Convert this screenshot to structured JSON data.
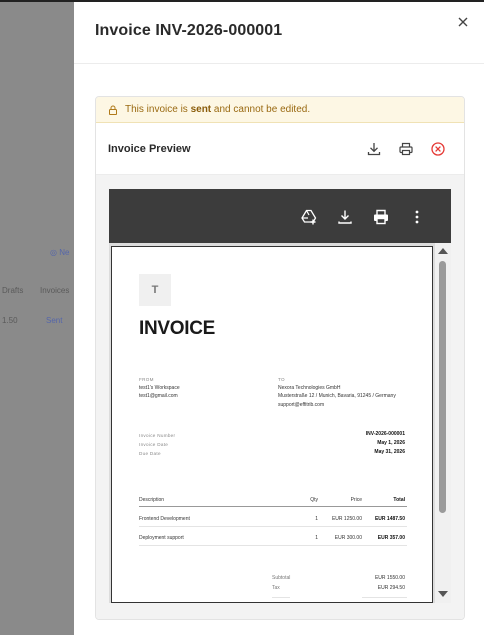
{
  "background": {
    "fragments": [
      "◎ Ne",
      "Drafts",
      "Invoices",
      "1.50",
      "Sent"
    ]
  },
  "drawer": {
    "title": "Invoice INV-2026-000001",
    "close_icon": "close-icon"
  },
  "alert": {
    "prefix": "This invoice is ",
    "status": "sent",
    "suffix": " and cannot be edited.",
    "icon": "lock-icon",
    "color": "#9a6a12"
  },
  "preview": {
    "title": "Invoice Preview",
    "actions": [
      "download-icon",
      "print-icon",
      "close-circle-icon"
    ],
    "close_color": "#e53935"
  },
  "viewer": {
    "toolbar_icons": [
      "add-to-drive-icon",
      "download-icon",
      "print-icon",
      "more-vert-icon"
    ]
  },
  "invoice": {
    "logo_letter": "T",
    "title": "INVOICE",
    "from_label": "FROM",
    "from_lines": [
      "test1's Workspace",
      "test1@gmail.com"
    ],
    "to_label": "TO",
    "to_lines": [
      "Nexora Technologies GmbH",
      "Musterstraße 12 / Munich, Bavaria, 91245 / Germany",
      "support@effitrib.com"
    ],
    "meta": [
      {
        "label": "Invoice Number",
        "value": "INV-2026-000001"
      },
      {
        "label": "Invoice Date",
        "value": "May 1, 2026"
      },
      {
        "label": "Due Date",
        "value": "May 31, 2026"
      }
    ],
    "columns": [
      "Description",
      "Qty",
      "Price",
      "Total"
    ],
    "items": [
      {
        "description": "Frontend Development",
        "qty": "1",
        "price": "EUR 1250.00",
        "total": "EUR 1487.50"
      },
      {
        "description": "Deployment support",
        "qty": "1",
        "price": "EUR 300.00",
        "total": "EUR 357.00"
      }
    ],
    "totals": [
      {
        "label": "Subtotal",
        "value": "EUR 1550.00"
      },
      {
        "label": "Tax",
        "value": "EUR 294.50"
      }
    ]
  }
}
